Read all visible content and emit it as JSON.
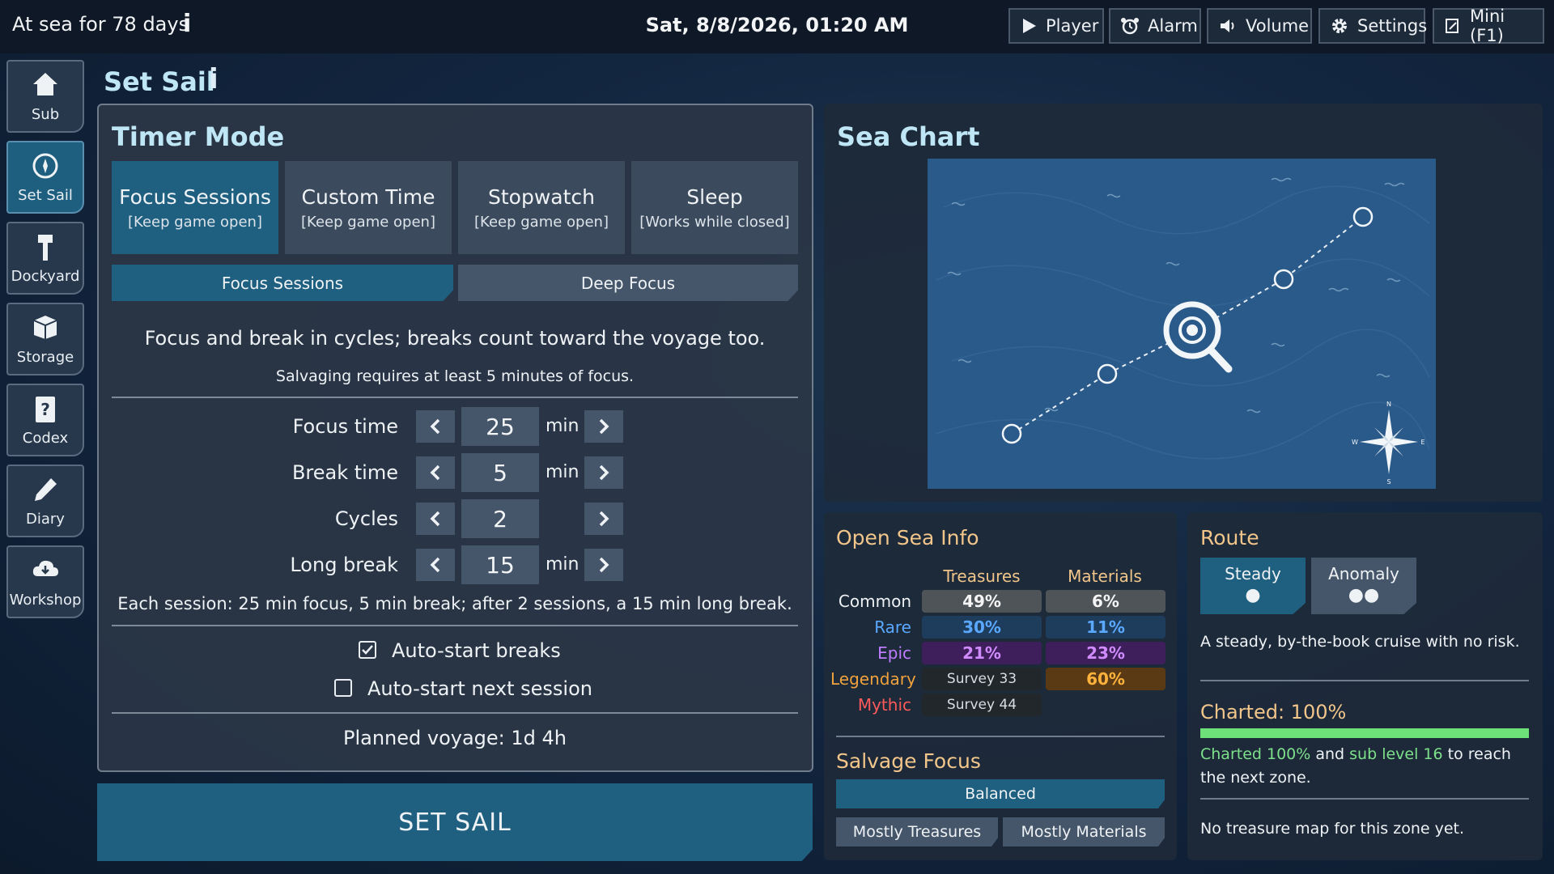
{
  "topbar": {
    "days_text": "At sea for 78 days",
    "info_glyph": "i",
    "datetime": "Sat, 8/8/2026, 01:20 AM",
    "buttons": {
      "player": "Player",
      "alarm": "Alarm",
      "volume": "Volume",
      "settings": "Settings",
      "mini": "Mini (F1)"
    }
  },
  "sidebar": {
    "items": [
      {
        "label": "Sub",
        "icon": "home-icon"
      },
      {
        "label": "Set Sail",
        "icon": "compass-icon",
        "active": true
      },
      {
        "label": "Dockyard",
        "icon": "hammer-icon"
      },
      {
        "label": "Storage",
        "icon": "box-icon"
      },
      {
        "label": "Codex",
        "icon": "book-icon"
      },
      {
        "label": "Diary",
        "icon": "pencil-icon"
      },
      {
        "label": "Workshop",
        "icon": "cloud-download-icon"
      }
    ]
  },
  "page": {
    "title": "Set Sail",
    "info_glyph": "i"
  },
  "timer": {
    "title": "Timer Mode",
    "modes": [
      {
        "title": "Focus Sessions",
        "note": "[Keep game open]",
        "active": true
      },
      {
        "title": "Custom Time",
        "note": "[Keep game open]"
      },
      {
        "title": "Stopwatch",
        "note": "[Keep game open]"
      },
      {
        "title": "Sleep",
        "note": "[Works while closed]"
      }
    ],
    "subtabs": [
      {
        "label": "Focus Sessions",
        "active": true
      },
      {
        "label": "Deep Focus"
      }
    ],
    "description": "Focus and break in cycles; breaks count toward the voyage too.",
    "requirement": "Salvaging requires at least 5 minutes of focus.",
    "rows": [
      {
        "label": "Focus time",
        "value": "25",
        "unit": "min"
      },
      {
        "label": "Break time",
        "value": "5",
        "unit": "min"
      },
      {
        "label": "Cycles",
        "value": "2",
        "unit": ""
      },
      {
        "label": "Long break",
        "value": "15",
        "unit": "min"
      }
    ],
    "session_summary": "Each session: 25 min focus, 5 min break; after 2 sessions, a 15 min long break.",
    "auto_start_breaks": {
      "label": "Auto-start breaks",
      "checked": true
    },
    "auto_start_next": {
      "label": "Auto-start next session",
      "checked": false
    },
    "planned_voyage": "Planned voyage: 1d 4h",
    "set_sail_label": "SET SAIL"
  },
  "sea_chart": {
    "title": "Sea Chart",
    "compass_labels": {
      "n": "N",
      "s": "S",
      "e": "E",
      "w": "W"
    }
  },
  "sea_info": {
    "title": "Open Sea Info",
    "columns": [
      "Treasures",
      "Materials"
    ],
    "rows": [
      {
        "rarity": "Common",
        "color": "#eef2f5",
        "treasures": "49%",
        "materials": "6%"
      },
      {
        "rarity": "Rare",
        "color": "#5aa8ff",
        "treasures": "30%",
        "materials": "11%"
      },
      {
        "rarity": "Epic",
        "color": "#c07cff",
        "treasures": "21%",
        "materials": "23%"
      },
      {
        "rarity": "Legendary",
        "color": "#f0a23c",
        "treasures": "Survey 33",
        "materials": "60%"
      },
      {
        "rarity": "Mythic",
        "color": "#ff5a5a",
        "treasures": "Survey 44",
        "materials": ""
      }
    ],
    "salvage_title": "Salvage Focus",
    "salvage_selected": "Balanced",
    "salvage_options": [
      "Mostly Treasures",
      "Mostly Materials"
    ]
  },
  "route": {
    "title": "Route",
    "options": [
      {
        "label": "Steady",
        "dots": "●",
        "active": true
      },
      {
        "label": "Anomaly",
        "dots": "●●"
      }
    ],
    "description": "A steady, by-the-book cruise with no risk.",
    "charted_label": "Charted: 100%",
    "charted_progress": 1.0,
    "charted_progress_color": "#6ee07a",
    "requirement_part1": "Charted 100%",
    "requirement_part2": " and ",
    "requirement_part3": "sub level 16",
    "requirement_part4": " to reach the next zone.",
    "map_note": "No treasure map for this zone yet."
  },
  "colors": {
    "accent": "#1f5f7f",
    "heading": "#bfe6f4",
    "section": "#f2c68a",
    "map_bg": "#2a5a8a"
  }
}
